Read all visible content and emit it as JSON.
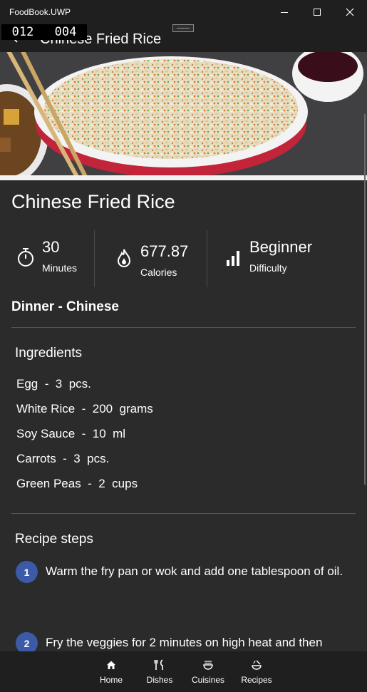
{
  "window": {
    "app_title": "FoodBook.UWP"
  },
  "debug": {
    "left": "012",
    "right": "004"
  },
  "header": {
    "title": "Chinese Fried Rice"
  },
  "dish": {
    "title": "Chinese Fried Rice",
    "time_value": "30",
    "time_label": "Minutes",
    "calories_value": "677.87",
    "calories_label": "Calories",
    "difficulty_value": "Beginner",
    "difficulty_label": "Difficulty",
    "category": "Dinner - Chinese"
  },
  "ingredients": {
    "title": "Ingredients",
    "items": [
      "Egg  -  3  pcs.",
      "White Rice  -  200  grams",
      "Soy Sauce  -  10  ml",
      "Carrots  -  3  pcs.",
      "Green Peas  -  2  cups"
    ]
  },
  "steps": {
    "title": "Recipe steps",
    "items": [
      {
        "number": "1",
        "text": "Warm the fry pan or wok and add one tablespoon of oil."
      },
      {
        "number": "2",
        "text": "Fry the veggies for 2 minutes on high heat and then"
      }
    ]
  },
  "nav": {
    "items": [
      {
        "label": "Home",
        "icon": "home-icon"
      },
      {
        "label": "Dishes",
        "icon": "fork-knife-icon"
      },
      {
        "label": "Cuisines",
        "icon": "bowl-icon"
      },
      {
        "label": "Recipes",
        "icon": "cooking-pot-icon"
      }
    ]
  },
  "colors": {
    "background": "#2b2b2b",
    "bars": "#1f1f1f",
    "step_badge": "#3c5aa8"
  }
}
